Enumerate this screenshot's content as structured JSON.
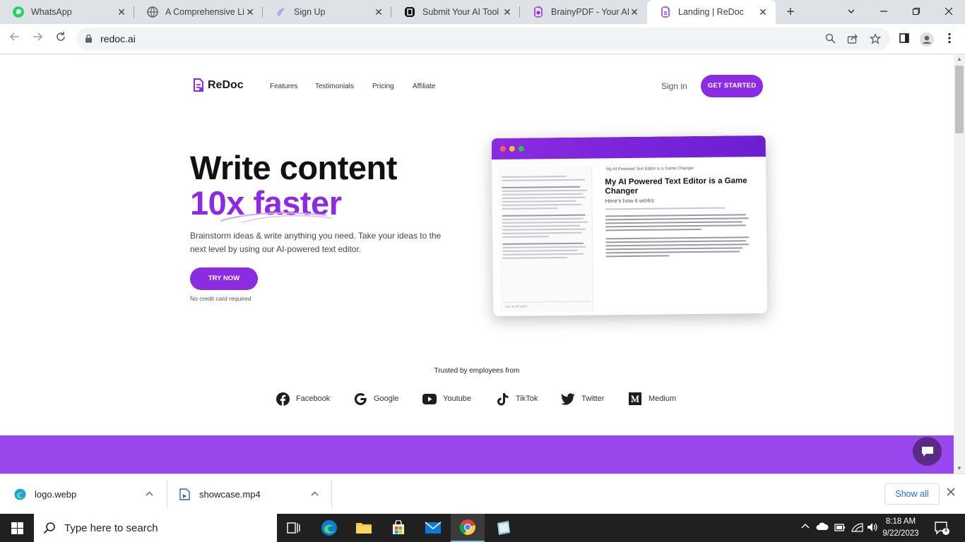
{
  "browser": {
    "tabs": [
      {
        "title": "WhatsApp",
        "icon": "whatsapp-icon",
        "color": "#25d366"
      },
      {
        "title": "A Comprehensive List",
        "icon": "globe-icon",
        "color": "#5f6368"
      },
      {
        "title": "Sign Up",
        "icon": "signup-icon",
        "color": "#b9a6f3"
      },
      {
        "title": "Submit Your AI Tool | T",
        "icon": "submit-icon",
        "color": "#111111"
      },
      {
        "title": "BrainyPDF - Your AI pc",
        "icon": "brainypdf-icon",
        "color": "#8b2be2"
      },
      {
        "title": "Landing | ReDoc",
        "icon": "redoc-icon",
        "color": "#8b2be2"
      }
    ],
    "url": "redoc.ai"
  },
  "page": {
    "logo": "ReDoc",
    "nav": [
      "Features",
      "Testimonials",
      "Pricing",
      "Affiliate"
    ],
    "signin": "Sign in",
    "get_started": "GET STARTED",
    "hero_line1": "Write content",
    "hero_line2": "10x faster",
    "hero_sub": "Brainstorm ideas & write anything you need. Take your ideas to the next level by using our AI-powered text editor.",
    "try_now": "TRY NOW",
    "no_card": "No credit card required",
    "mockup": {
      "doc_title": "My AI Powered Text Editor is a Game Changer",
      "doc_subtitle": "Here's how it works",
      "top_title": "My AI Powered Text Editor is a Game Changer",
      "input_placeholder": "Ask an AI writer"
    },
    "trusted": "Trusted by employees from",
    "brands": [
      "Facebook",
      "Google",
      "Youtube",
      "TikTok",
      "Twitter",
      "Medium"
    ]
  },
  "downloads": {
    "items": [
      "logo.webp",
      "showcase.mp4"
    ],
    "show_all": "Show all"
  },
  "taskbar": {
    "search_placeholder": "Type here to search",
    "time": "8:18 AM",
    "date": "9/22/2023",
    "notification_count": "1"
  }
}
